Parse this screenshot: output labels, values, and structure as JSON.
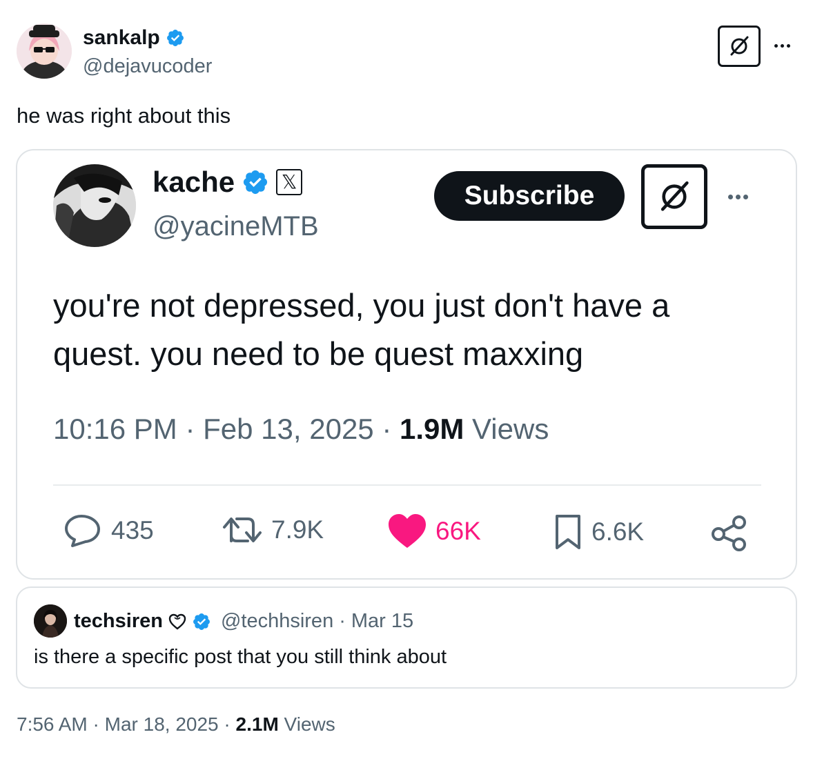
{
  "outer_post": {
    "display_name": "sankalp",
    "handle": "@dejavucoder",
    "text": "he was right about this",
    "time": "7:56 AM",
    "date": "Mar 18, 2025",
    "views_count": "2.1M",
    "views_label": "Views",
    "separator": "·",
    "verified_icon": "verified-badge-icon",
    "grok_icon": "grok-icon",
    "more_icon": "more-options-icon"
  },
  "quoted_post": {
    "display_name": "kache",
    "handle": "@yacineMTB",
    "affiliate_badge": "𝕏",
    "subscribe_label": "Subscribe",
    "text": "you're not depressed, you just don't have a quest. you need to be quest maxxing",
    "time": "10:16 PM",
    "date": "Feb 13, 2025",
    "views_count": "1.9M",
    "views_label": "Views",
    "separator": "·",
    "stats": {
      "replies": "435",
      "reposts": "7.9K",
      "likes": "66K",
      "bookmarks": "6.6K"
    },
    "like_color": "#f91880"
  },
  "reply_context": {
    "display_name": "techsiren",
    "handle": "@techhsiren",
    "date": "Mar 15",
    "separator": "·",
    "text": "is there a specific post that you still think about"
  },
  "colors": {
    "text_primary": "#0f1419",
    "text_secondary": "#536471",
    "verified_blue": "#1d9bf0",
    "border": "#dfe3e6"
  }
}
